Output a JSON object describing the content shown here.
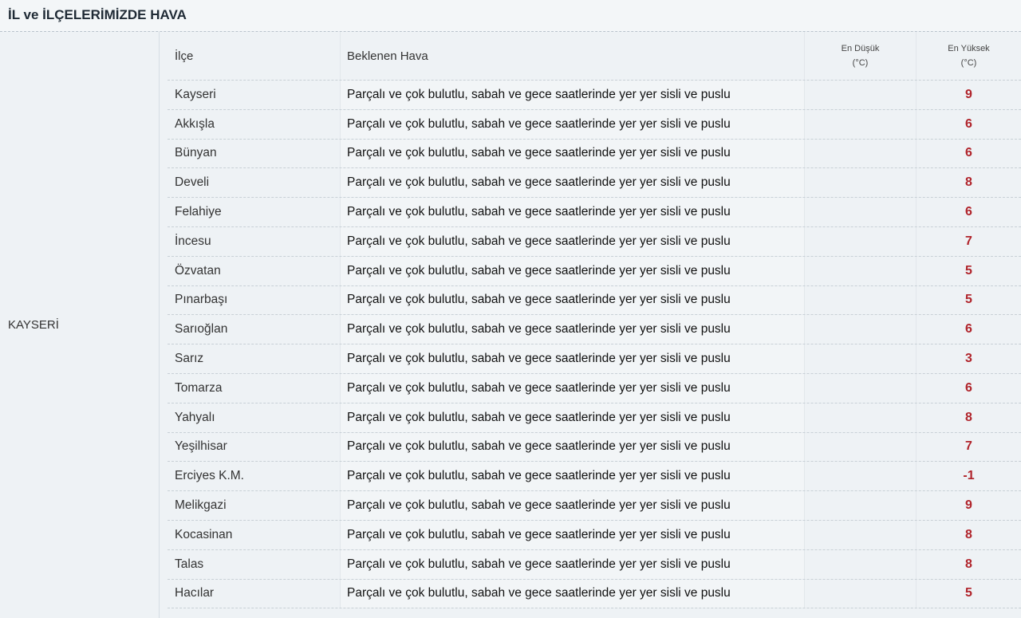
{
  "header": {
    "title": "İL ve İLÇELERİMİZDE HAVA"
  },
  "province": {
    "name": "KAYSERİ"
  },
  "table": {
    "columns": {
      "ilce": "İlçe",
      "desc": "Beklenen Hava",
      "min_label": "En Düşük",
      "min_unit": "(°C)",
      "max_label": "En Yüksek",
      "max_unit": "(°C)"
    },
    "rows": [
      {
        "ilce": "Kayseri",
        "desc": "Parçalı ve çok bulutlu, sabah ve gece saatlerinde yer yer sisli ve puslu",
        "min": "",
        "max": "9"
      },
      {
        "ilce": "Akkışla",
        "desc": "Parçalı ve çok bulutlu, sabah ve gece saatlerinde yer yer sisli ve puslu",
        "min": "",
        "max": "6"
      },
      {
        "ilce": "Bünyan",
        "desc": "Parçalı ve çok bulutlu, sabah ve gece saatlerinde yer yer sisli ve puslu",
        "min": "",
        "max": "6"
      },
      {
        "ilce": "Develi",
        "desc": "Parçalı ve çok bulutlu, sabah ve gece saatlerinde yer yer sisli ve puslu",
        "min": "",
        "max": "8"
      },
      {
        "ilce": "Felahiye",
        "desc": "Parçalı ve çok bulutlu, sabah ve gece saatlerinde yer yer sisli ve puslu",
        "min": "",
        "max": "6"
      },
      {
        "ilce": "İncesu",
        "desc": "Parçalı ve çok bulutlu, sabah ve gece saatlerinde yer yer sisli ve puslu",
        "min": "",
        "max": "7"
      },
      {
        "ilce": "Özvatan",
        "desc": "Parçalı ve çok bulutlu, sabah ve gece saatlerinde yer yer sisli ve puslu",
        "min": "",
        "max": "5"
      },
      {
        "ilce": "Pınarbaşı",
        "desc": "Parçalı ve çok bulutlu, sabah ve gece saatlerinde yer yer sisli ve puslu",
        "min": "",
        "max": "5"
      },
      {
        "ilce": "Sarıoğlan",
        "desc": "Parçalı ve çok bulutlu, sabah ve gece saatlerinde yer yer sisli ve puslu",
        "min": "",
        "max": "6"
      },
      {
        "ilce": "Sarız",
        "desc": "Parçalı ve çok bulutlu, sabah ve gece saatlerinde yer yer sisli ve puslu",
        "min": "",
        "max": "3"
      },
      {
        "ilce": "Tomarza",
        "desc": "Parçalı ve çok bulutlu, sabah ve gece saatlerinde yer yer sisli ve puslu",
        "min": "",
        "max": "6"
      },
      {
        "ilce": "Yahyalı",
        "desc": "Parçalı ve çok bulutlu, sabah ve gece saatlerinde yer yer sisli ve puslu",
        "min": "",
        "max": "8"
      },
      {
        "ilce": "Yeşilhisar",
        "desc": "Parçalı ve çok bulutlu, sabah ve gece saatlerinde yer yer sisli ve puslu",
        "min": "",
        "max": "7"
      },
      {
        "ilce": "Erciyes K.M.",
        "desc": "Parçalı ve çok bulutlu, sabah ve gece saatlerinde yer yer sisli ve puslu",
        "min": "",
        "max": "-1"
      },
      {
        "ilce": "Melikgazi",
        "desc": "Parçalı ve çok bulutlu, sabah ve gece saatlerinde yer yer sisli ve puslu",
        "min": "",
        "max": "9"
      },
      {
        "ilce": "Kocasinan",
        "desc": "Parçalı ve çok bulutlu, sabah ve gece saatlerinde yer yer sisli ve puslu",
        "min": "",
        "max": "8"
      },
      {
        "ilce": "Talas",
        "desc": "Parçalı ve çok bulutlu, sabah ve gece saatlerinde yer yer sisli ve puslu",
        "min": "",
        "max": "8"
      },
      {
        "ilce": "Hacılar",
        "desc": "Parçalı ve çok bulutlu, sabah ve gece saatlerinde yer yer sisli ve puslu",
        "min": "",
        "max": "5"
      }
    ]
  },
  "colors": {
    "max_temp": "#b0232a",
    "background": "#eef2f5"
  }
}
